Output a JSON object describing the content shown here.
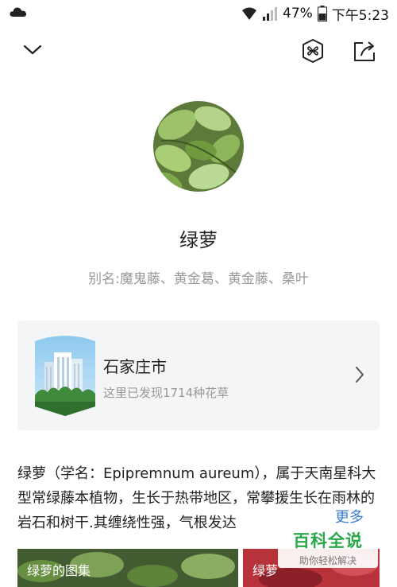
{
  "status_bar": {
    "battery": "47%",
    "time": "下午5:23"
  },
  "plant": {
    "name": "绿萝",
    "alias_label": "别名",
    "alias_values": "魔鬼藤、黄金葛、黄金藤、桑叶"
  },
  "city_card": {
    "title": "石家庄市",
    "subtitle": "这里已发现1714种花草"
  },
  "description": {
    "text": "绿萝（学名：Epipremnum aureum），属于天南星科大型常绿藤本植物，生长于热带地区，常攀援生长在雨林的岩石和树干.其缠绕性强，气根发达",
    "more_label": "更多"
  },
  "image_cards": [
    {
      "label": "绿萝的图集"
    },
    {
      "label": "绿萝"
    }
  ],
  "watermark": {
    "title": "百科全说",
    "subtitle": "助你轻松解决"
  },
  "colors": {
    "accent_link": "#3a7bd5",
    "watermark_green": "#2aa84a"
  },
  "icons": [
    "cloud-icon",
    "wifi-icon",
    "signal-icon",
    "battery-icon",
    "chevron-down-icon",
    "plant-scan-icon",
    "share-icon",
    "chevron-right-icon"
  ]
}
